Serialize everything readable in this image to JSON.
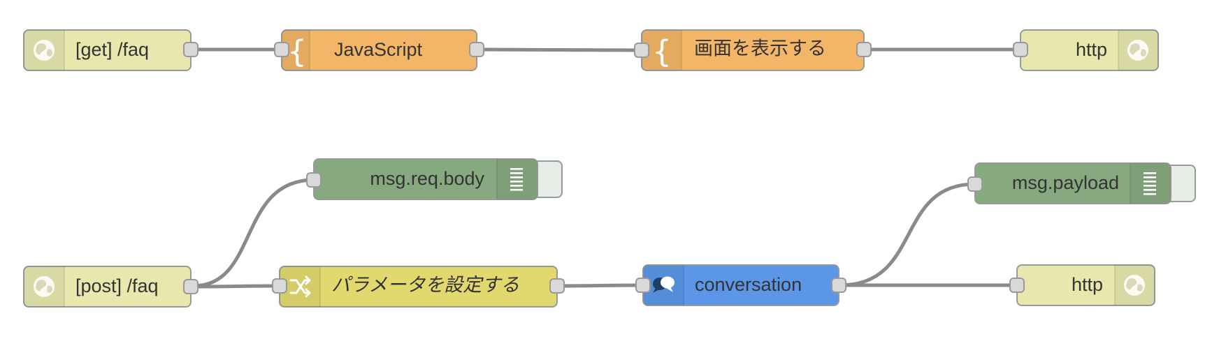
{
  "colors": {
    "http": "#e7e7ae",
    "function": "#f3b567",
    "debug": "#87a980",
    "change": "#e2d96e",
    "conversation": "#5b97e6",
    "wire": "#8a8a8a",
    "port": "#d9d9d9",
    "border": "#999999"
  },
  "flows": {
    "top": {
      "http_in": {
        "label": "[get] /faq",
        "icon": "globe-icon"
      },
      "function_1": {
        "label": "JavaScript",
        "icon": "function-brace-icon"
      },
      "function_2": {
        "label": "画面を表示する",
        "icon": "function-brace-icon"
      },
      "http_response": {
        "label": "http",
        "icon": "globe-icon"
      }
    },
    "bottom": {
      "http_in": {
        "label": "[post] /faq",
        "icon": "globe-icon"
      },
      "debug_1": {
        "label": "msg.req.body",
        "icon": "debug-lines-icon"
      },
      "change": {
        "label": "パラメータを設定する",
        "icon": "shuffle-icon"
      },
      "conversation": {
        "label": "conversation",
        "icon": "chat-bubbles-icon"
      },
      "debug_2": {
        "label": "msg.payload",
        "icon": "debug-lines-icon"
      },
      "http_response": {
        "label": "http",
        "icon": "globe-icon"
      }
    }
  }
}
